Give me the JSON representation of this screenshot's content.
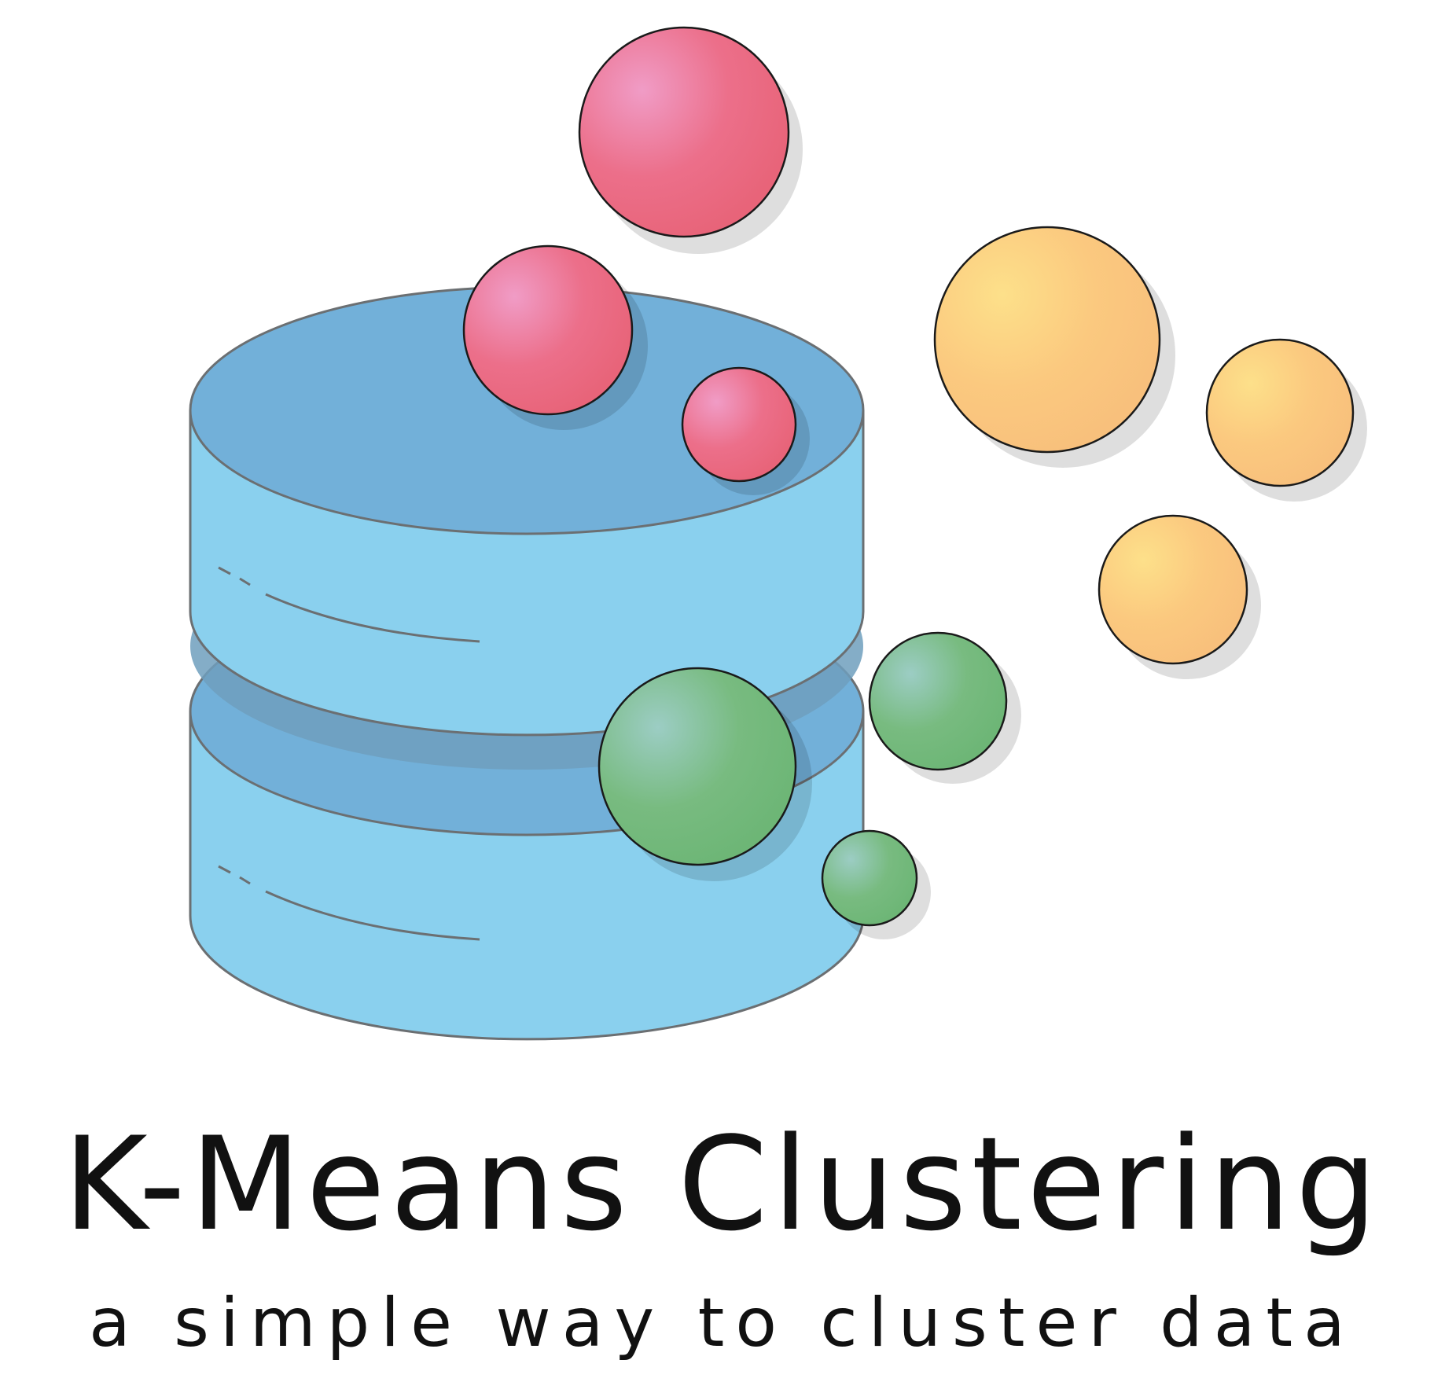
{
  "logo": {
    "title": "K-Means Clustering",
    "subtitle": "a simple way to cluster data"
  },
  "colors": {
    "background": "#ffffff",
    "database_side": "#8ad0ee",
    "database_top": "#72b0d9",
    "database_outline": "#6b6f72",
    "cluster_red": "#ea6680",
    "cluster_orange": "#f9c57e",
    "cluster_green": "#72b87c",
    "text": "#111111"
  },
  "icons": {
    "database": "database-icon",
    "clusters": [
      "red-cluster",
      "orange-cluster",
      "green-cluster"
    ]
  }
}
